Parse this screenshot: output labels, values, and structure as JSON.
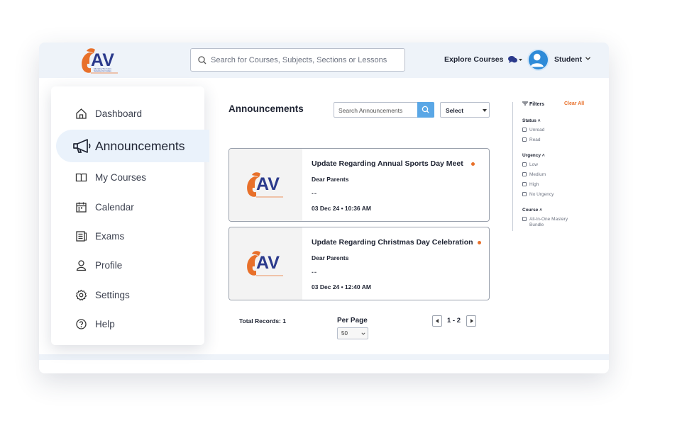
{
  "header": {
    "logo_tagline": "Educating The Future Nurturing Our Culture",
    "search_placeholder": "Search for Courses, Subjects, Sections or Lessons",
    "explore_label": "Explore Courses",
    "user_name": "Student"
  },
  "sidebar": {
    "items": [
      {
        "label": "Dashboard",
        "icon": "home-icon"
      },
      {
        "label": "Announcements",
        "icon": "megaphone-icon",
        "active": true
      },
      {
        "label": "My Courses",
        "icon": "book-icon"
      },
      {
        "label": "Calendar",
        "icon": "calendar-icon"
      },
      {
        "label": "Exams",
        "icon": "exam-icon"
      },
      {
        "label": "Profile",
        "icon": "user-icon"
      },
      {
        "label": "Settings",
        "icon": "gear-icon"
      },
      {
        "label": "Help",
        "icon": "help-icon"
      }
    ]
  },
  "main": {
    "title": "Announcements",
    "search_placeholder": "Search Announcements",
    "select_label": "Select",
    "announcements": [
      {
        "title": "Update Regarding Annual Sports Day Meet",
        "greeting": "Dear Parents",
        "ellipsis": "...",
        "date": "03 Dec 24 • 10:36 AM"
      },
      {
        "title": "Update Regarding Christmas Day Celebration",
        "greeting": "Dear Parents",
        "ellipsis": "...",
        "date": "03 Dec 24 • 12:40 AM"
      }
    ],
    "total_records": "Total Records: 1",
    "per_page_label": "Per Page",
    "per_page_value": "50",
    "page_range": "1 - 2"
  },
  "filters": {
    "title": "Filters",
    "clear_all": "Clear All",
    "status_label": "Status",
    "status_options": [
      "Unread",
      "Read"
    ],
    "urgency_label": "Urgency",
    "urgency_options": [
      "Low",
      "Medium",
      "High",
      "No Urgency"
    ],
    "course_label": "Course",
    "course_options": [
      "All-In-One Mastery Bundle"
    ]
  },
  "colors": {
    "accent": "#e8702a",
    "brand_blue": "#2b3a8c",
    "button_blue": "#5aa7e6",
    "header_bg": "#eef3f9"
  }
}
